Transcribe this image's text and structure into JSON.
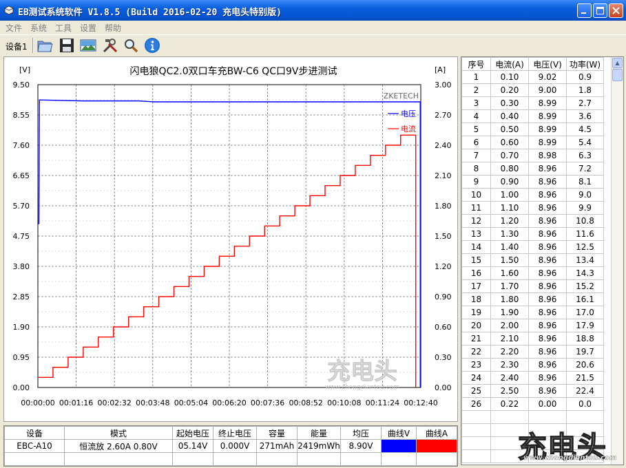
{
  "window": {
    "title": "EB测试系统软件 V1.8.5 (Build 2016-02-20 充电头特别版)"
  },
  "menu": [
    "文件",
    "系统",
    "工具",
    "设置",
    "帮助"
  ],
  "toolbar": {
    "device_label": "设备1",
    "icons": [
      "open-folder-icon",
      "save-disk-icon",
      "chart-picture-icon",
      "tools-icon",
      "zoom-icon",
      "info-icon"
    ]
  },
  "chart_data": {
    "type": "line",
    "title": "闪电狼QC2.0双口车充BW-C6 QC口9V步进测试",
    "y_left_unit": "[V]",
    "y_right_unit": "[A]",
    "ylim_left": [
      0,
      9.5
    ],
    "ylim_right": [
      0,
      3.0
    ],
    "y_left_ticks": [
      "9.50",
      "8.55",
      "7.60",
      "6.65",
      "5.70",
      "4.75",
      "3.80",
      "2.85",
      "1.90",
      "0.95",
      "0.00"
    ],
    "y_right_ticks": [
      "3.00",
      "2.70",
      "2.40",
      "2.10",
      "1.80",
      "1.50",
      "1.20",
      "0.90",
      "0.60",
      "0.30",
      "0.00"
    ],
    "x_ticks": [
      "00:00:00",
      "00:01:16",
      "00:02:32",
      "00:03:48",
      "00:05:04",
      "00:06:20",
      "00:07:36",
      "00:08:52",
      "00:10:08",
      "00:11:24",
      "00:12:40"
    ],
    "x_seconds_range": [
      0,
      760
    ],
    "grid": true,
    "brand_label": "ZKETECH",
    "legend": {
      "placement": "top-right",
      "voltage": "电压",
      "current": "电流"
    },
    "series": [
      {
        "name": "电压",
        "axis": "left",
        "color": "#0000ff",
        "points": [
          [
            0,
            5.14
          ],
          [
            2,
            5.14
          ],
          [
            3,
            9.02
          ],
          [
            60,
            9.0
          ],
          [
            90,
            8.99
          ],
          [
            200,
            8.99
          ],
          [
            210,
            8.98
          ],
          [
            230,
            8.96
          ],
          [
            759,
            8.96
          ],
          [
            759,
            0.0
          ]
        ]
      },
      {
        "name": "电流",
        "axis": "right",
        "color": "#ff0000",
        "step_seconds": 30,
        "values": [
          0.1,
          0.2,
          0.3,
          0.4,
          0.5,
          0.6,
          0.7,
          0.8,
          0.9,
          1.0,
          1.1,
          1.2,
          1.3,
          1.4,
          1.5,
          1.6,
          1.7,
          1.8,
          1.9,
          2.0,
          2.1,
          2.2,
          2.3,
          2.4,
          2.5,
          0.22
        ]
      }
    ]
  },
  "info": {
    "headers": [
      "设备",
      "模式",
      "起始电压",
      "终止电压",
      "容量",
      "能量",
      "均压",
      "曲线V",
      "曲线A"
    ],
    "row": {
      "device": "EBC-A10",
      "mode": "恒流放 2.60A 0.80V",
      "start_v": "05.14V",
      "end_v": "0.000V",
      "capacity": "271mAh",
      "energy": "2419mWh",
      "avg_v": "8.90V"
    },
    "curve_v_color": "#0000ff",
    "curve_a_color": "#ff0000"
  },
  "data_table": {
    "headers": [
      "序号",
      "电流(A)",
      "电压(V)",
      "功率(W)"
    ],
    "rows": [
      [
        "1",
        "0.10",
        "9.02",
        "0.9"
      ],
      [
        "2",
        "0.20",
        "9.00",
        "1.8"
      ],
      [
        "3",
        "0.30",
        "8.99",
        "2.7"
      ],
      [
        "4",
        "0.40",
        "8.99",
        "3.6"
      ],
      [
        "5",
        "0.50",
        "8.99",
        "4.5"
      ],
      [
        "6",
        "0.60",
        "8.99",
        "5.4"
      ],
      [
        "7",
        "0.70",
        "8.98",
        "6.3"
      ],
      [
        "8",
        "0.80",
        "8.96",
        "7.2"
      ],
      [
        "9",
        "0.90",
        "8.96",
        "8.1"
      ],
      [
        "10",
        "1.00",
        "8.96",
        "9.0"
      ],
      [
        "11",
        "1.10",
        "8.96",
        "9.9"
      ],
      [
        "12",
        "1.20",
        "8.96",
        "10.8"
      ],
      [
        "13",
        "1.30",
        "8.96",
        "11.6"
      ],
      [
        "14",
        "1.40",
        "8.96",
        "12.5"
      ],
      [
        "15",
        "1.50",
        "8.96",
        "13.4"
      ],
      [
        "16",
        "1.60",
        "8.96",
        "14.3"
      ],
      [
        "17",
        "1.70",
        "8.96",
        "15.2"
      ],
      [
        "18",
        "1.80",
        "8.96",
        "16.1"
      ],
      [
        "19",
        "1.90",
        "8.96",
        "17.0"
      ],
      [
        "20",
        "2.00",
        "8.96",
        "17.9"
      ],
      [
        "21",
        "2.10",
        "8.96",
        "18.8"
      ],
      [
        "22",
        "2.20",
        "8.96",
        "19.7"
      ],
      [
        "23",
        "2.30",
        "8.96",
        "20.6"
      ],
      [
        "24",
        "2.40",
        "8.96",
        "21.5"
      ],
      [
        "25",
        "2.50",
        "8.96",
        "22.4"
      ],
      [
        "26",
        "0.22",
        "0.00",
        "0.0"
      ]
    ]
  },
  "watermark": {
    "logo": "充电头",
    "url": "www.chongdiantou.com"
  }
}
